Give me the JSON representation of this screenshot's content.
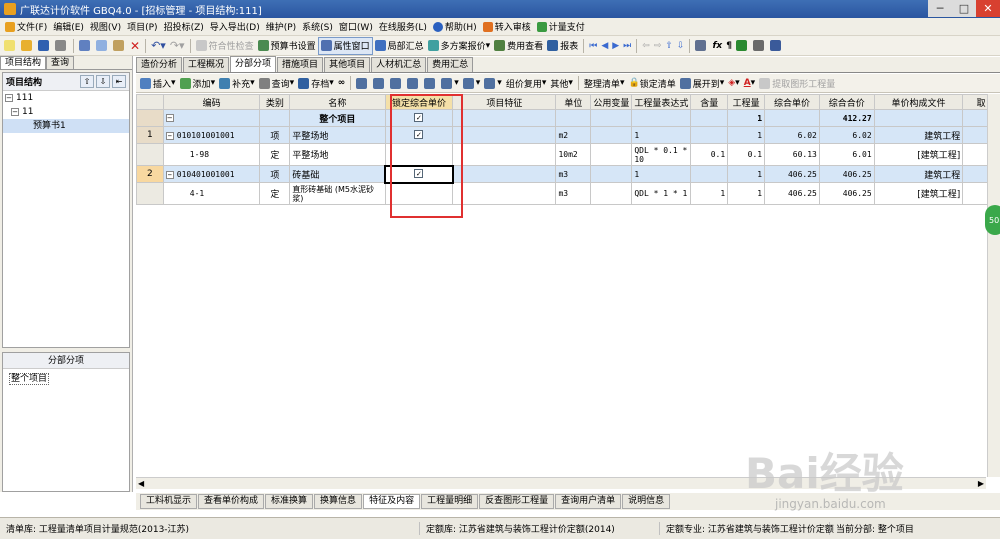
{
  "window": {
    "title": "广联达计价软件 GBQ4.0 - [招标管理 - 项目结构:111]"
  },
  "menu": [
    {
      "label": "文件(F)"
    },
    {
      "label": "编辑(E)"
    },
    {
      "label": "视图(V)"
    },
    {
      "label": "项目(P)"
    },
    {
      "label": "招投标(Z)"
    },
    {
      "label": "导入导出(D)"
    },
    {
      "label": "维护(P)"
    },
    {
      "label": "系统(S)"
    },
    {
      "label": "窗口(W)"
    },
    {
      "label": "在线服务(L)"
    },
    {
      "label": "帮助(H)"
    },
    {
      "label": "转入审核"
    },
    {
      "label": "计量支付"
    }
  ],
  "toolbar1": {
    "compliance_check": "符合性检查",
    "budget_settings": "预算书设置",
    "property_window": "属性窗口",
    "local_summary": "局部汇总",
    "multi_quote": "多方案报价",
    "fee_view": "费用查看",
    "report": "报表"
  },
  "left": {
    "tabs": [
      "项目结构",
      "查询"
    ],
    "header": "项目结构",
    "tree": [
      "111",
      "11",
      "预算书1"
    ],
    "panel2_title": "分部分项",
    "panel2_item": "整个项目"
  },
  "main_tabs": [
    "造价分析",
    "工程概况",
    "分部分项",
    "措施项目",
    "其他项目",
    "人材机汇总",
    "费用汇总"
  ],
  "toolbar2": {
    "insert": "插入",
    "add": "添加",
    "supplement": "补充",
    "query": "查询",
    "save": "存档",
    "group_reuse": "组价复用",
    "other": "其他",
    "organize": "整理清单",
    "lock": "锁定清单",
    "expand": "展开到",
    "extract": "提取图形工程量"
  },
  "grid": {
    "headers": [
      "编码",
      "类别",
      "名称",
      "锁定综合单价",
      "项目特征",
      "单位",
      "公用变量",
      "工程量表达式",
      "含量",
      "工程量",
      "综合单价",
      "综合合价",
      "单价构成文件",
      "取"
    ],
    "summary": {
      "name": "整个项目",
      "qty": "1",
      "total": "412.27"
    },
    "rows": [
      {
        "num": "1",
        "code": "010101001001",
        "type": "项",
        "name": "平整场地",
        "unit": "m2",
        "expr": "1",
        "content": "",
        "qty": "1",
        "unit_price": "6.02",
        "total": "6.02",
        "file": "建筑工程"
      },
      {
        "num": "",
        "code": "1-98",
        "type": "定",
        "name": "平整场地",
        "unit": "10m2",
        "expr": "QDL * 0.1 * 10",
        "content": "0.1",
        "qty": "0.1",
        "unit_price": "60.13",
        "total": "6.01",
        "file": "[建筑工程]"
      },
      {
        "num": "2",
        "code": "010401001001",
        "type": "项",
        "name": "砖基础",
        "unit": "m3",
        "expr": "1",
        "content": "",
        "qty": "1",
        "unit_price": "406.25",
        "total": "406.25",
        "file": "建筑工程"
      },
      {
        "num": "",
        "code": "4-1",
        "type": "定",
        "name": "直形砖基础 (M5水泥砂浆)",
        "unit": "m3",
        "expr": "QDL * 1 * 1",
        "content": "1",
        "qty": "1",
        "unit_price": "406.25",
        "total": "406.25",
        "file": "[建筑工程]"
      }
    ]
  },
  "bottom_tabs": [
    "工料机显示",
    "查看单价构成",
    "标准换算",
    "换算信息",
    "特征及内容",
    "工程量明细",
    "反查图形工程量",
    "查询用户清单",
    "说明信息"
  ],
  "status": {
    "list_lib": "清单库:  工程量清单项目计量规范(2013-江苏)",
    "quota_lib": "定额库:  江苏省建筑与装饰工程计价定额(2014)",
    "quota_major": "定额专业:  江苏省建筑与装饰工程计价定额",
    "current_section": "当前分部:  整个项目"
  },
  "watermark": {
    "main": "Bai经验",
    "sub": "jingyan.baidu.com"
  },
  "badge": "50"
}
